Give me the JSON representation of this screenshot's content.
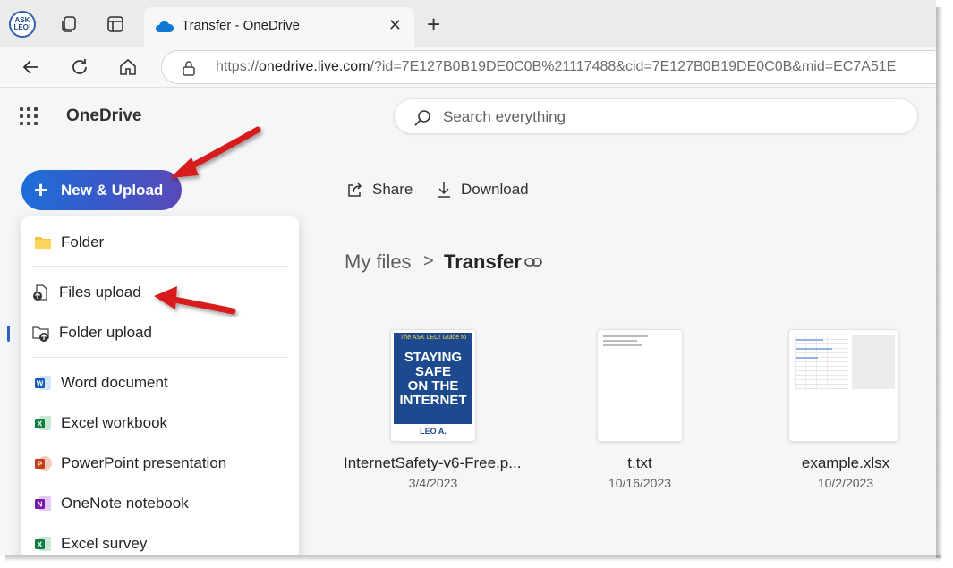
{
  "browser": {
    "tab": {
      "title": "Transfer - OneDrive",
      "close_glyph": "✕"
    },
    "new_tab_glyph": "+",
    "profile_badge": "ASK LEO!",
    "url": {
      "prefix": "https://",
      "host": "onedrive.live.com",
      "rest": "/?id=7E127B0B19DE0C0B%21117488&cid=7E127B0B19DE0C0B&mid=EC7A51E"
    }
  },
  "app": {
    "name": "OneDrive",
    "search_placeholder": "Search everything"
  },
  "new_button": {
    "glyph": "+",
    "label": "New & Upload"
  },
  "menu": {
    "items": [
      {
        "label": "Folder",
        "icon": "folder-icon"
      },
      {
        "label": "Files upload",
        "icon": "file-upload-icon"
      },
      {
        "label": "Folder upload",
        "icon": "folder-upload-icon"
      },
      {
        "label": "Word document",
        "icon": "word-icon"
      },
      {
        "label": "Excel workbook",
        "icon": "excel-icon"
      },
      {
        "label": "PowerPoint presentation",
        "icon": "powerpoint-icon"
      },
      {
        "label": "OneNote notebook",
        "icon": "onenote-icon"
      },
      {
        "label": "Excel survey",
        "icon": "excel-survey-icon"
      }
    ]
  },
  "commands": {
    "share": "Share",
    "download": "Download"
  },
  "breadcrumb": {
    "parent": "My files",
    "separator": ">",
    "current": "Transfer"
  },
  "files": [
    {
      "name": "InternetSafety-v6-Free.p...",
      "date": "3/4/2023",
      "cover": {
        "top": "The ASK LEO! Guide to",
        "title_lines": [
          "STAYING",
          "SAFE",
          "ON THE",
          "INTERNET"
        ],
        "author": "LEO A. NOTENBOOM"
      }
    },
    {
      "name": "t.txt",
      "date": "10/16/2023"
    },
    {
      "name": "example.xlsx",
      "date": "10/2/2023"
    }
  ],
  "colors": {
    "brand_blue": "#1c6fd8",
    "brand_purple": "#5a49b8",
    "arrow_red": "#d81e1e",
    "word": "#185abd",
    "excel": "#107c41",
    "powerpoint": "#c43e1c",
    "onenote": "#7719aa"
  }
}
